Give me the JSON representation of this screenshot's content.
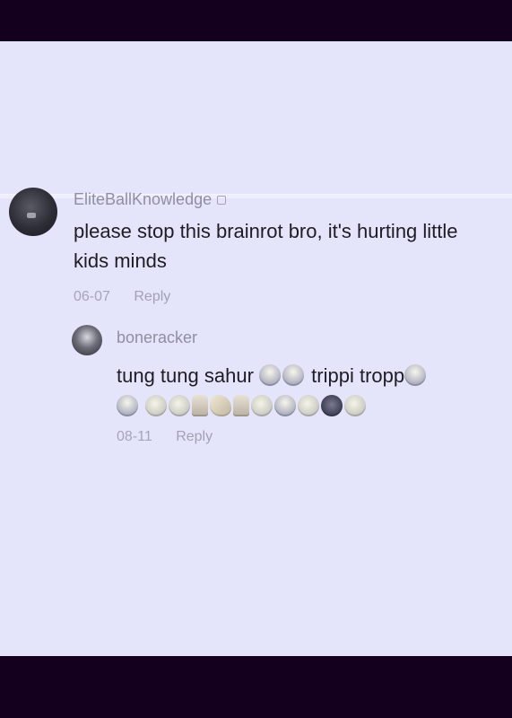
{
  "comments": [
    {
      "username": "EliteBallKnowledge",
      "text": "please stop this brainrot bro, it's hurting little kids minds",
      "date": "06-07",
      "reply_label": "Reply"
    }
  ],
  "replies": [
    {
      "username": "boneracker",
      "line1_text_a": "tung tung sahur",
      "line1_text_b": "trippi tropp",
      "date": "08-11",
      "reply_label": "Reply",
      "emoji_line1": [
        "laugh-cry-emoji",
        "laugh-cry-emoji",
        "laugh-cry-emoji"
      ],
      "emoji_line2": [
        "laugh-cry-emoji",
        "star-eyes-emoji",
        "star-eyes-emoji",
        "praying-hands-emoji",
        "clapping-hands-emoji",
        "praying-hands-emoji",
        "surprised-emoji",
        "laugh-cry-emoji",
        "star-eyes-emoji",
        "devil-emoji",
        "smile-emoji"
      ]
    }
  ]
}
